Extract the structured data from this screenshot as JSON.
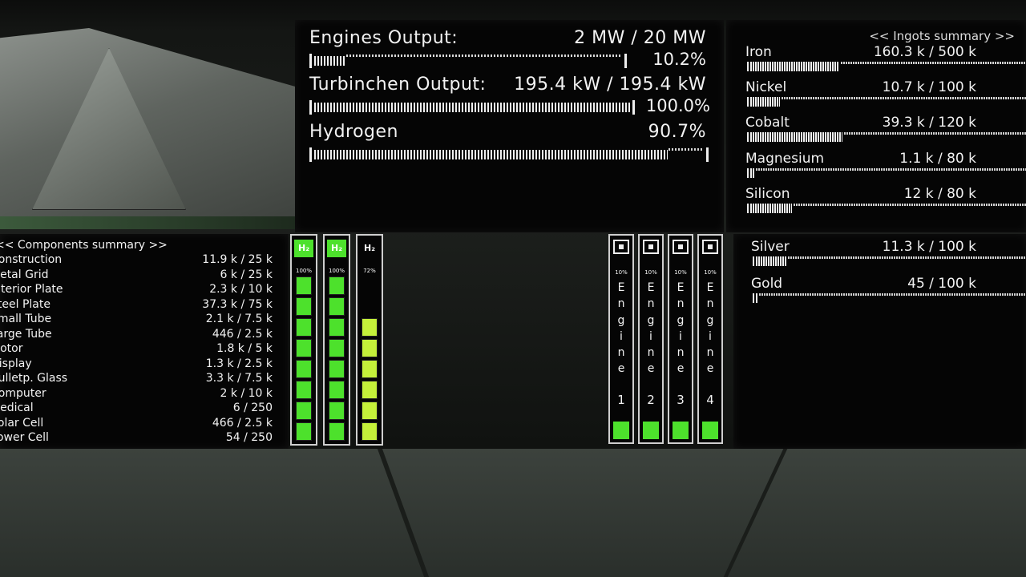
{
  "engines": {
    "output_label": "Engines Output:",
    "output_value": "2 MW / 20 MW",
    "output_percent": "10.2%",
    "output_fraction": 0.102,
    "turbine_label": "Turbinchen Output:",
    "turbine_value": "195.4 kW / 195.4 kW",
    "turbine_percent": "100.0%",
    "turbine_fraction": 1.0,
    "hydrogen_label": "Hydrogen",
    "hydrogen_percent": "90.7%",
    "hydrogen_fraction": 0.907
  },
  "ingots": {
    "title": "<< Ingots summary >>",
    "items": [
      {
        "name": "Iron",
        "value": "160.3 k / 500 k",
        "fraction": 0.32
      },
      {
        "name": "Nickel",
        "value": "10.7 k / 100 k",
        "fraction": 0.107
      },
      {
        "name": "Cobalt",
        "value": "39.3 k / 120 k",
        "fraction": 0.33
      },
      {
        "name": "Magnesium",
        "value": "1.1 k / 80 k",
        "fraction": 0.014
      },
      {
        "name": "Silicon",
        "value": "12 k / 80 k",
        "fraction": 0.15
      },
      {
        "name": "Silver",
        "value": "11.3 k / 100 k",
        "fraction": 0.113
      },
      {
        "name": "Gold",
        "value": "45 / 100 k",
        "fraction": 0.0005
      }
    ]
  },
  "components": {
    "title": "<< Components summary >>",
    "items": [
      {
        "name": "Construction",
        "value": "11.9 k / 25 k"
      },
      {
        "name": "Metal Grid",
        "value": "6 k / 25 k"
      },
      {
        "name": "Interior Plate",
        "value": "2.3 k / 10 k"
      },
      {
        "name": "Steel Plate",
        "value": "37.3 k / 75 k"
      },
      {
        "name": "Small Tube",
        "value": "2.1 k / 7.5 k"
      },
      {
        "name": "Large Tube",
        "value": "446 / 2.5 k"
      },
      {
        "name": "Motor",
        "value": "1.8 k / 5 k"
      },
      {
        "name": "Display",
        "value": "1.3 k / 2.5 k"
      },
      {
        "name": "Bulletp. Glass",
        "value": "3.3 k / 7.5 k"
      },
      {
        "name": "Computer",
        "value": "2 k / 10 k"
      },
      {
        "name": "Medical",
        "value": "6 / 250"
      },
      {
        "name": "Solar Cell",
        "value": "466 / 2.5 k"
      },
      {
        "name": "Power Cell",
        "value": "54 / 250"
      }
    ]
  },
  "tanks": [
    {
      "label": "H₂",
      "percent": "100%",
      "fraction": 1.0,
      "color": "#4de12c"
    },
    {
      "label": "H₂",
      "percent": "100%",
      "fraction": 1.0,
      "color": "#4de12c"
    },
    {
      "label": "H₂",
      "percent": "72%",
      "fraction": 0.72,
      "color": "#c4f03a"
    }
  ],
  "engine_columns": [
    {
      "name": "Engine",
      "number": "1",
      "percent": "10%",
      "fraction": 0.1
    },
    {
      "name": "Engine",
      "number": "2",
      "percent": "10%",
      "fraction": 0.1
    },
    {
      "name": "Engine",
      "number": "3",
      "percent": "10%",
      "fraction": 0.1
    },
    {
      "name": "Engine",
      "number": "4",
      "percent": "10%",
      "fraction": 0.1
    }
  ],
  "colors": {
    "accent_green": "#4de12c",
    "accent_lime": "#c4f03a",
    "text": "#f2f2f2"
  }
}
